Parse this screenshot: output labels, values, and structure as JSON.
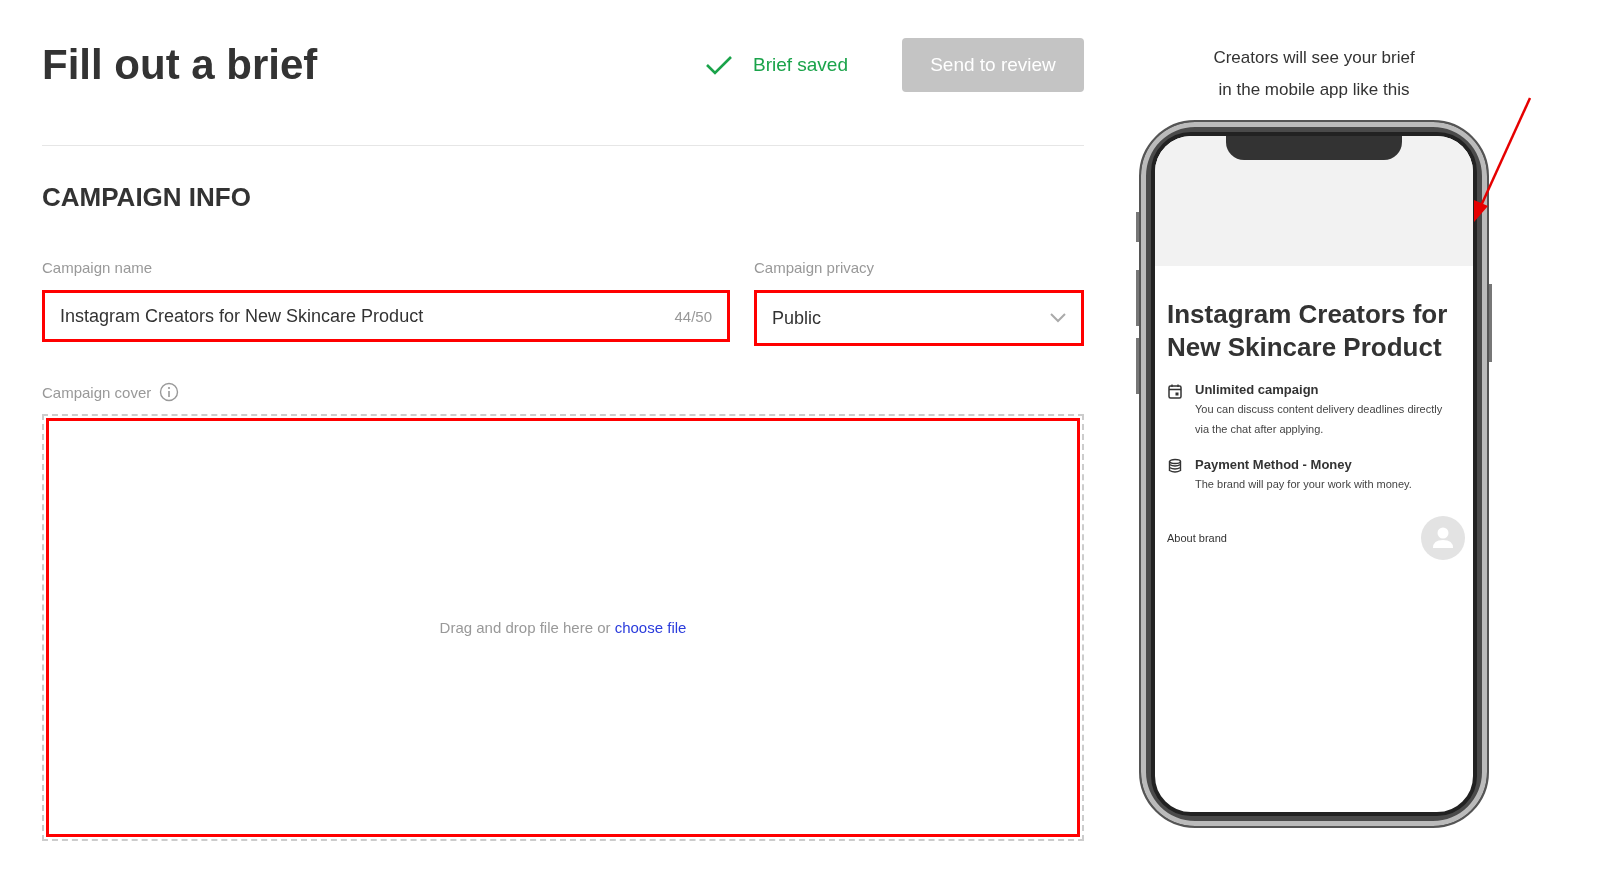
{
  "header": {
    "title": "Fill out a brief",
    "save_status": "Brief saved",
    "send_button": {
      "label": "Send to review",
      "disabled": true
    }
  },
  "section_title": "CAMPAIGN INFO",
  "name_field": {
    "label": "Campaign name",
    "value": "Instagram Creators for New Skincare Product",
    "counter": "44/50"
  },
  "privacy_field": {
    "label": "Campaign privacy",
    "value": "Public"
  },
  "cover": {
    "label": "Campaign cover",
    "prompt": "Drag and drop file here or",
    "link": "choose file"
  },
  "preview": {
    "caption": "Creators will see your brief\nin the mobile app like this",
    "title": "Instagram Creators for New Skincare Product",
    "details": [
      {
        "kind": "calendar",
        "heading": "Unlimited campaign",
        "text": "You can discuss content delivery deadlines directly via the chat after applying."
      },
      {
        "kind": "coins",
        "heading": "Payment Method - Money",
        "text": "The brand will pay for your work with money."
      }
    ],
    "about": "About brand"
  }
}
